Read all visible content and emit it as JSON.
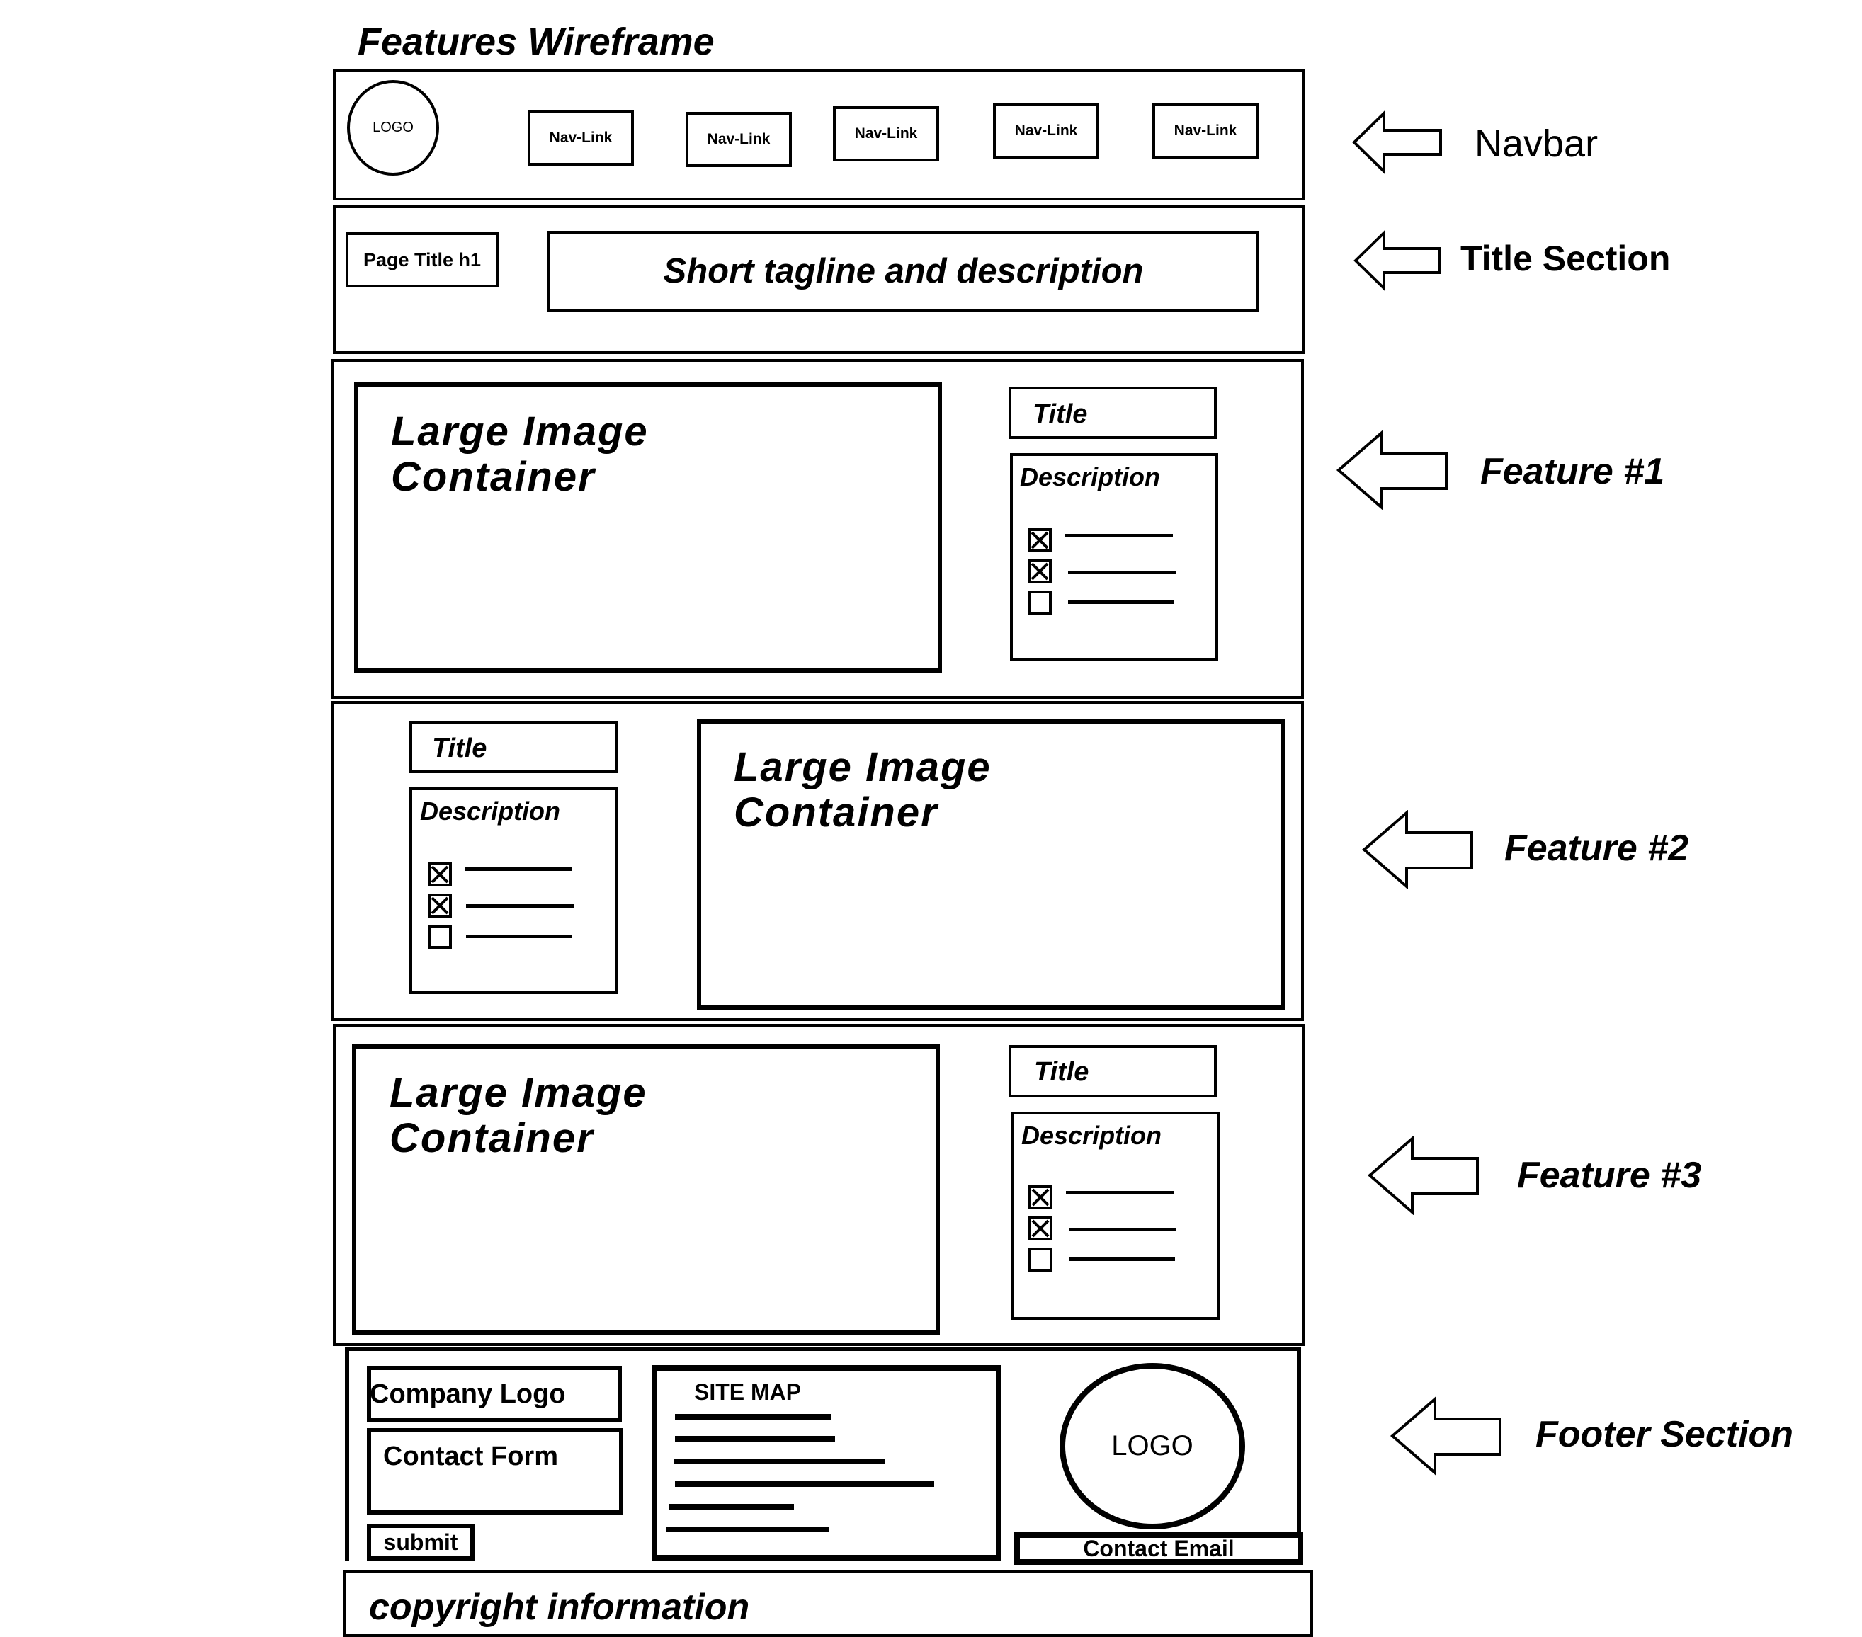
{
  "diagram_title": "Features Wireframe",
  "navbar": {
    "logo": "LOGO",
    "links": [
      "Nav-Link",
      "Nav-Link",
      "Nav-Link",
      "Nav-Link",
      "Nav-Link"
    ]
  },
  "title_section": {
    "page_title": "Page Title h1",
    "tagline": "Short tagline and description"
  },
  "features": [
    {
      "image": "Large Image Container",
      "image_line1": "Large Image",
      "image_line2": "Container",
      "title": "Title",
      "description": "Description"
    },
    {
      "image": "Large Image Container",
      "image_line1": "Large Image",
      "image_line2": "Container",
      "title": "Title",
      "description": "Description"
    },
    {
      "image": "Large Image Container",
      "image_line1": "Large Image",
      "image_line2": "Container",
      "title": "Title",
      "description": "Description"
    }
  ],
  "checklist": [
    {
      "checked": true
    },
    {
      "checked": true
    },
    {
      "checked": false
    }
  ],
  "footer": {
    "company_logo": "Company Logo",
    "contact_form": "Contact Form",
    "submit": "submit",
    "site_map": "SITE MAP",
    "logo": "LOGO",
    "contact_email": "Contact Email",
    "copyright": "copyright information"
  },
  "annotations": {
    "navbar": "Navbar",
    "title_section": "Title Section",
    "feature1": "Feature #1",
    "feature2": "Feature #2",
    "feature3": "Feature #3",
    "footer": "Footer Section"
  }
}
